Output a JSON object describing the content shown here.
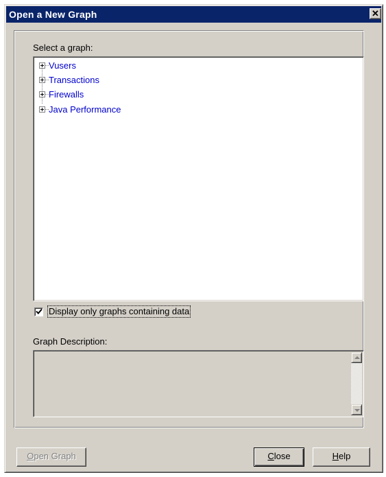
{
  "window": {
    "title": "Open a New Graph",
    "close_glyph": "✕"
  },
  "select": {
    "label": "Select a graph:",
    "tree_items": [
      {
        "label": "Vusers",
        "expander": "plus-box-icon"
      },
      {
        "label": "Transactions",
        "expander": "plus-box-icon"
      },
      {
        "label": "Firewalls",
        "expander": "plus-box-icon"
      },
      {
        "label": "Java Performance",
        "expander": "plus-box-icon"
      }
    ]
  },
  "filter": {
    "label": "Display only graphs containing data",
    "checked": true
  },
  "description": {
    "label": "Graph Description:",
    "text": ""
  },
  "buttons": {
    "open_graph": {
      "mnemonic": "O",
      "rest": "pen Graph",
      "enabled": false
    },
    "close": {
      "mnemonic": "C",
      "rest": "lose"
    },
    "help": {
      "mnemonic": "H",
      "rest": "elp"
    }
  },
  "colors": {
    "titlebar": "#0a246a",
    "tree_text": "#0000cc",
    "face": "#d4d0c8"
  }
}
